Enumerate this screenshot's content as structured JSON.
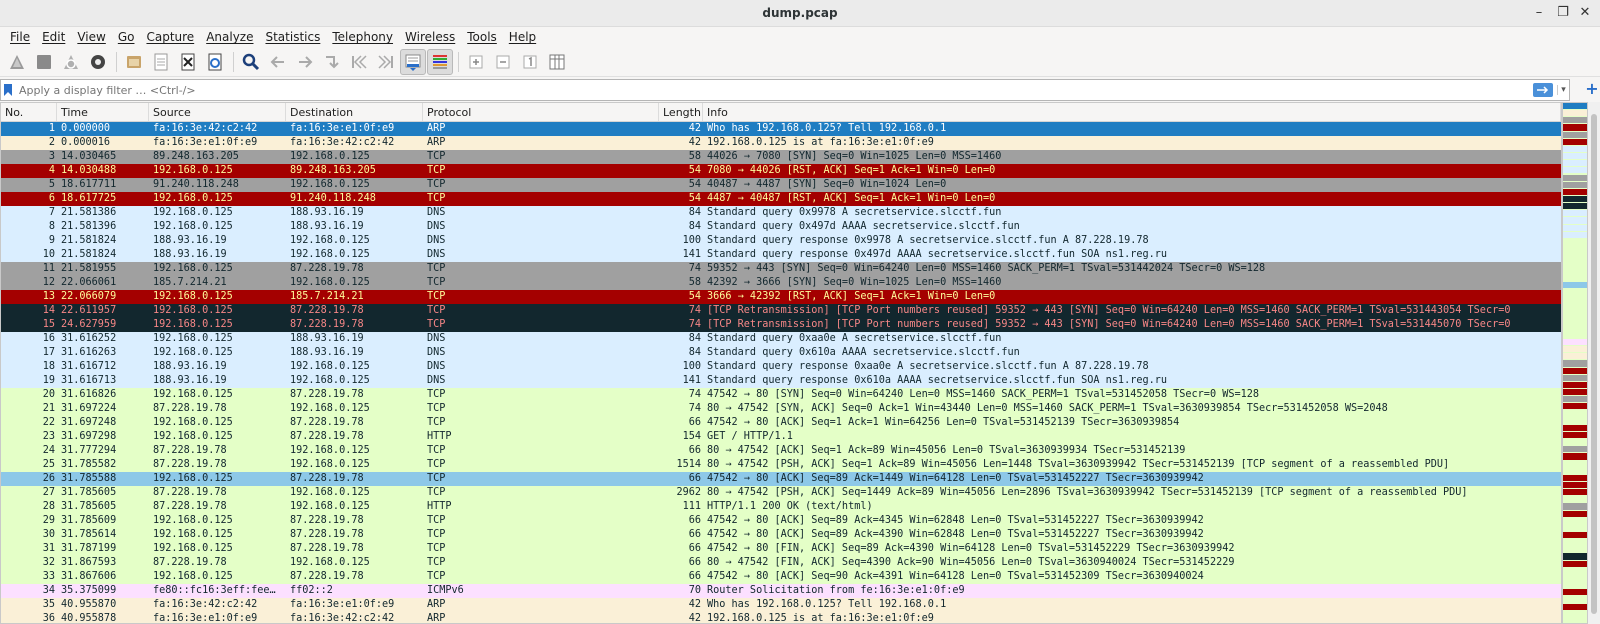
{
  "window": {
    "title": "dump.pcap",
    "minimize": "–",
    "maximize": "❐",
    "close": "✕"
  },
  "menu": [
    "File",
    "Edit",
    "View",
    "Go",
    "Capture",
    "Analyze",
    "Statistics",
    "Telephony",
    "Wireless",
    "Tools",
    "Help"
  ],
  "toolbar": {
    "icons": [
      "start-capture-icon",
      "stop-capture-icon",
      "restart-capture-icon",
      "capture-options-icon",
      "open-file-icon",
      "save-file-icon",
      "close-file-icon",
      "reload-file-icon",
      "find-packet-icon",
      "go-back-icon",
      "go-forward-icon",
      "go-to-packet-icon",
      "go-first-icon",
      "go-last-icon",
      "autoscroll-icon",
      "colorize-icon",
      "zoom-in-icon",
      "zoom-out-icon",
      "normal-size-icon",
      "resize-columns-icon"
    ]
  },
  "filter": {
    "placeholder": "Apply a display filter … <Ctrl-/>"
  },
  "columns": {
    "no": "No.",
    "time": "Time",
    "source": "Source",
    "destination": "Destination",
    "protocol": "Protocol",
    "length": "Length",
    "info": "Info"
  },
  "colors": {
    "selected": "#1f7dc2",
    "arp": "#faf0d7",
    "tcp_gray": "#a0a0a0",
    "tcp_rst": "#a40000",
    "dns": "#daeeff",
    "bad_tcp": "#12272e",
    "http": "#e4ffc7",
    "selected_light": "#8dc8e8",
    "icmpv6": "#fce0ff"
  },
  "packets": [
    {
      "no": "1",
      "time": "0.000000",
      "src": "fa:16:3e:42:c2:42",
      "dst": "fa:16:3e:e1:0f:e9",
      "proto": "ARP",
      "len": "42",
      "info": "Who has 192.168.0.125? Tell 192.168.0.1",
      "bg": "#1f7dc2",
      "fg": "#ffffff"
    },
    {
      "no": "2",
      "time": "0.000016",
      "src": "fa:16:3e:e1:0f:e9",
      "dst": "fa:16:3e:42:c2:42",
      "proto": "ARP",
      "len": "42",
      "info": "192.168.0.125 is at fa:16:3e:e1:0f:e9",
      "bg": "#faf0d7",
      "fg": "#12272e"
    },
    {
      "no": "3",
      "time": "14.030465",
      "src": "89.248.163.205",
      "dst": "192.168.0.125",
      "proto": "TCP",
      "len": "58",
      "info": "44026 → 7080 [SYN] Seq=0 Win=1025 Len=0 MSS=1460",
      "bg": "#a0a0a0",
      "fg": "#12272e"
    },
    {
      "no": "4",
      "time": "14.030488",
      "src": "192.168.0.125",
      "dst": "89.248.163.205",
      "proto": "TCP",
      "len": "54",
      "info": "7080 → 44026 [RST, ACK] Seq=1 Ack=1 Win=0 Len=0",
      "bg": "#a40000",
      "fg": "#fffc9c"
    },
    {
      "no": "5",
      "time": "18.617711",
      "src": "91.240.118.248",
      "dst": "192.168.0.125",
      "proto": "TCP",
      "len": "54",
      "info": "40487 → 4487 [SYN] Seq=0 Win=1024 Len=0",
      "bg": "#a0a0a0",
      "fg": "#12272e"
    },
    {
      "no": "6",
      "time": "18.617725",
      "src": "192.168.0.125",
      "dst": "91.240.118.248",
      "proto": "TCP",
      "len": "54",
      "info": "4487 → 40487 [RST, ACK] Seq=1 Ack=1 Win=0 Len=0",
      "bg": "#a40000",
      "fg": "#fffc9c"
    },
    {
      "no": "7",
      "time": "21.581386",
      "src": "192.168.0.125",
      "dst": "188.93.16.19",
      "proto": "DNS",
      "len": "84",
      "info": "Standard query 0x9978 A secretservice.slcctf.fun",
      "bg": "#daeeff",
      "fg": "#12272e"
    },
    {
      "no": "8",
      "time": "21.581396",
      "src": "192.168.0.125",
      "dst": "188.93.16.19",
      "proto": "DNS",
      "len": "84",
      "info": "Standard query 0x497d AAAA secretservice.slcctf.fun",
      "bg": "#daeeff",
      "fg": "#12272e"
    },
    {
      "no": "9",
      "time": "21.581824",
      "src": "188.93.16.19",
      "dst": "192.168.0.125",
      "proto": "DNS",
      "len": "100",
      "info": "Standard query response 0x9978 A secretservice.slcctf.fun A 87.228.19.78",
      "bg": "#daeeff",
      "fg": "#12272e"
    },
    {
      "no": "10",
      "time": "21.581824",
      "src": "188.93.16.19",
      "dst": "192.168.0.125",
      "proto": "DNS",
      "len": "141",
      "info": "Standard query response 0x497d AAAA secretservice.slcctf.fun SOA ns1.reg.ru",
      "bg": "#daeeff",
      "fg": "#12272e"
    },
    {
      "no": "11",
      "time": "21.581955",
      "src": "192.168.0.125",
      "dst": "87.228.19.78",
      "proto": "TCP",
      "len": "74",
      "info": "59352 → 443 [SYN] Seq=0 Win=64240 Len=0 MSS=1460 SACK_PERM=1 TSval=531442024 TSecr=0 WS=128",
      "bg": "#a0a0a0",
      "fg": "#12272e"
    },
    {
      "no": "12",
      "time": "22.066061",
      "src": "185.7.214.21",
      "dst": "192.168.0.125",
      "proto": "TCP",
      "len": "58",
      "info": "42392 → 3666 [SYN] Seq=0 Win=1025 Len=0 MSS=1460",
      "bg": "#a0a0a0",
      "fg": "#12272e"
    },
    {
      "no": "13",
      "time": "22.066079",
      "src": "192.168.0.125",
      "dst": "185.7.214.21",
      "proto": "TCP",
      "len": "54",
      "info": "3666 → 42392 [RST, ACK] Seq=1 Ack=1 Win=0 Len=0",
      "bg": "#a40000",
      "fg": "#fffc9c"
    },
    {
      "no": "14",
      "time": "22.611957",
      "src": "192.168.0.125",
      "dst": "87.228.19.78",
      "proto": "TCP",
      "len": "74",
      "info": "[TCP Retransmission] [TCP Port numbers reused] 59352 → 443 [SYN] Seq=0 Win=64240 Len=0 MSS=1460 SACK_PERM=1 TSval=531443054 TSecr=0",
      "bg": "#12272e",
      "fg": "#f78787"
    },
    {
      "no": "15",
      "time": "24.627959",
      "src": "192.168.0.125",
      "dst": "87.228.19.78",
      "proto": "TCP",
      "len": "74",
      "info": "[TCP Retransmission] [TCP Port numbers reused] 59352 → 443 [SYN] Seq=0 Win=64240 Len=0 MSS=1460 SACK_PERM=1 TSval=531445070 TSecr=0",
      "bg": "#12272e",
      "fg": "#f78787"
    },
    {
      "no": "16",
      "time": "31.616252",
      "src": "192.168.0.125",
      "dst": "188.93.16.19",
      "proto": "DNS",
      "len": "84",
      "info": "Standard query 0xaa0e A secretservice.slcctf.fun",
      "bg": "#daeeff",
      "fg": "#12272e"
    },
    {
      "no": "17",
      "time": "31.616263",
      "src": "192.168.0.125",
      "dst": "188.93.16.19",
      "proto": "DNS",
      "len": "84",
      "info": "Standard query 0x610a AAAA secretservice.slcctf.fun",
      "bg": "#daeeff",
      "fg": "#12272e"
    },
    {
      "no": "18",
      "time": "31.616712",
      "src": "188.93.16.19",
      "dst": "192.168.0.125",
      "proto": "DNS",
      "len": "100",
      "info": "Standard query response 0xaa0e A secretservice.slcctf.fun A 87.228.19.78",
      "bg": "#daeeff",
      "fg": "#12272e"
    },
    {
      "no": "19",
      "time": "31.616713",
      "src": "188.93.16.19",
      "dst": "192.168.0.125",
      "proto": "DNS",
      "len": "141",
      "info": "Standard query response 0x610a AAAA secretservice.slcctf.fun SOA ns1.reg.ru",
      "bg": "#daeeff",
      "fg": "#12272e"
    },
    {
      "no": "20",
      "time": "31.616826",
      "src": "192.168.0.125",
      "dst": "87.228.19.78",
      "proto": "TCP",
      "len": "74",
      "info": "47542 → 80 [SYN] Seq=0 Win=64240 Len=0 MSS=1460 SACK_PERM=1 TSval=531452058 TSecr=0 WS=128",
      "bg": "#e4ffc7",
      "fg": "#12272e"
    },
    {
      "no": "21",
      "time": "31.697224",
      "src": "87.228.19.78",
      "dst": "192.168.0.125",
      "proto": "TCP",
      "len": "74",
      "info": "80 → 47542 [SYN, ACK] Seq=0 Ack=1 Win=43440 Len=0 MSS=1460 SACK_PERM=1 TSval=3630939854 TSecr=531452058 WS=2048",
      "bg": "#e4ffc7",
      "fg": "#12272e"
    },
    {
      "no": "22",
      "time": "31.697248",
      "src": "192.168.0.125",
      "dst": "87.228.19.78",
      "proto": "TCP",
      "len": "66",
      "info": "47542 → 80 [ACK] Seq=1 Ack=1 Win=64256 Len=0 TSval=531452139 TSecr=3630939854",
      "bg": "#e4ffc7",
      "fg": "#12272e"
    },
    {
      "no": "23",
      "time": "31.697298",
      "src": "192.168.0.125",
      "dst": "87.228.19.78",
      "proto": "HTTP",
      "len": "154",
      "info": "GET / HTTP/1.1",
      "bg": "#e4ffc7",
      "fg": "#12272e"
    },
    {
      "no": "24",
      "time": "31.777294",
      "src": "87.228.19.78",
      "dst": "192.168.0.125",
      "proto": "TCP",
      "len": "66",
      "info": "80 → 47542 [ACK] Seq=1 Ack=89 Win=45056 Len=0 TSval=3630939934 TSecr=531452139",
      "bg": "#e4ffc7",
      "fg": "#12272e"
    },
    {
      "no": "25",
      "time": "31.785582",
      "src": "87.228.19.78",
      "dst": "192.168.0.125",
      "proto": "TCP",
      "len": "1514",
      "info": "80 → 47542 [PSH, ACK] Seq=1 Ack=89 Win=45056 Len=1448 TSval=3630939942 TSecr=531452139 [TCP segment of a reassembled PDU]",
      "bg": "#e4ffc7",
      "fg": "#12272e"
    },
    {
      "no": "26",
      "time": "31.785588",
      "src": "192.168.0.125",
      "dst": "87.228.19.78",
      "proto": "TCP",
      "len": "66",
      "info": "47542 → 80 [ACK] Seq=89 Ack=1449 Win=64128 Len=0 TSval=531452227 TSecr=3630939942",
      "bg": "#8dc8e8",
      "fg": "#12272e"
    },
    {
      "no": "27",
      "time": "31.785605",
      "src": "87.228.19.78",
      "dst": "192.168.0.125",
      "proto": "TCP",
      "len": "2962",
      "info": "80 → 47542 [PSH, ACK] Seq=1449 Ack=89 Win=45056 Len=2896 TSval=3630939942 TSecr=531452139 [TCP segment of a reassembled PDU]",
      "bg": "#e4ffc7",
      "fg": "#12272e"
    },
    {
      "no": "28",
      "time": "31.785605",
      "src": "87.228.19.78",
      "dst": "192.168.0.125",
      "proto": "HTTP",
      "len": "111",
      "info": "HTTP/1.1 200 OK  (text/html)",
      "bg": "#e4ffc7",
      "fg": "#12272e"
    },
    {
      "no": "29",
      "time": "31.785609",
      "src": "192.168.0.125",
      "dst": "87.228.19.78",
      "proto": "TCP",
      "len": "66",
      "info": "47542 → 80 [ACK] Seq=89 Ack=4345 Win=62848 Len=0 TSval=531452227 TSecr=3630939942",
      "bg": "#e4ffc7",
      "fg": "#12272e"
    },
    {
      "no": "30",
      "time": "31.785614",
      "src": "192.168.0.125",
      "dst": "87.228.19.78",
      "proto": "TCP",
      "len": "66",
      "info": "47542 → 80 [ACK] Seq=89 Ack=4390 Win=62848 Len=0 TSval=531452227 TSecr=3630939942",
      "bg": "#e4ffc7",
      "fg": "#12272e"
    },
    {
      "no": "31",
      "time": "31.787199",
      "src": "192.168.0.125",
      "dst": "87.228.19.78",
      "proto": "TCP",
      "len": "66",
      "info": "47542 → 80 [FIN, ACK] Seq=89 Ack=4390 Win=64128 Len=0 TSval=531452229 TSecr=3630939942",
      "bg": "#e4ffc7",
      "fg": "#12272e"
    },
    {
      "no": "32",
      "time": "31.867593",
      "src": "87.228.19.78",
      "dst": "192.168.0.125",
      "proto": "TCP",
      "len": "66",
      "info": "80 → 47542 [FIN, ACK] Seq=4390 Ack=90 Win=45056 Len=0 TSval=3630940024 TSecr=531452229",
      "bg": "#e4ffc7",
      "fg": "#12272e"
    },
    {
      "no": "33",
      "time": "31.867606",
      "src": "192.168.0.125",
      "dst": "87.228.19.78",
      "proto": "TCP",
      "len": "66",
      "info": "47542 → 80 [ACK] Seq=90 Ack=4391 Win=64128 Len=0 TSval=531452309 TSecr=3630940024",
      "bg": "#e4ffc7",
      "fg": "#12272e"
    },
    {
      "no": "34",
      "time": "35.375099",
      "src": "fe80::fc16:3eff:fee…",
      "dst": "ff02::2",
      "proto": "ICMPv6",
      "len": "70",
      "info": "Router Solicitation from fe:16:3e:e1:0f:e9",
      "bg": "#fce0ff",
      "fg": "#12272e"
    },
    {
      "no": "35",
      "time": "40.955870",
      "src": "fa:16:3e:42:c2:42",
      "dst": "fa:16:3e:e1:0f:e9",
      "proto": "ARP",
      "len": "42",
      "info": "Who has 192.168.0.125? Tell 192.168.0.1",
      "bg": "#faf0d7",
      "fg": "#12272e"
    },
    {
      "no": "36",
      "time": "40.955878",
      "src": "fa:16:3e:e1:0f:e9",
      "dst": "fa:16:3e:42:c2:42",
      "proto": "ARP",
      "len": "42",
      "info": "192.168.0.125 is at fa:16:3e:e1:0f:e9",
      "bg": "#faf0d7",
      "fg": "#12272e"
    }
  ],
  "minimap_stripes": [
    "#1f7dc2",
    "#faf0d7",
    "#a0a0a0",
    "#a40000",
    "#a0a0a0",
    "#a40000",
    "#daeeff",
    "#daeeff",
    "#daeeff",
    "#daeeff",
    "#a0a0a0",
    "#a0a0a0",
    "#a40000",
    "#12272e",
    "#12272e",
    "#daeeff",
    "#daeeff",
    "#daeeff",
    "#daeeff",
    "#e4ffc7",
    "#e4ffc7",
    "#e4ffc7",
    "#e4ffc7",
    "#e4ffc7",
    "#e4ffc7",
    "#8dc8e8",
    "#e4ffc7",
    "#e4ffc7",
    "#e4ffc7",
    "#e4ffc7",
    "#e4ffc7",
    "#e4ffc7",
    "#e4ffc7",
    "#fce0ff",
    "#faf0d7",
    "#faf0d7",
    "#a0a0a0",
    "#a40000",
    "#a0a0a0",
    "#a40000",
    "#a40000",
    "#a0a0a0",
    "#a40000",
    "#e4ffc7",
    "#e4ffc7",
    "#a40000",
    "#a40000",
    "#e4ffc7",
    "#a0a0a0",
    "#a40000",
    "#e4ffc7",
    "#e4ffc7",
    "#a40000",
    "#a40000",
    "#a40000",
    "#e4ffc7",
    "#a0a0a0",
    "#a40000",
    "#e4ffc7",
    "#e4ffc7",
    "#a40000",
    "#e4ffc7",
    "#e4ffc7",
    "#12272e",
    "#a40000",
    "#e4ffc7",
    "#e4ffc7",
    "#e4ffc7",
    "#a40000",
    "#e4ffc7",
    "#a40000",
    "#e4ffc7",
    "#e4ffc7"
  ]
}
